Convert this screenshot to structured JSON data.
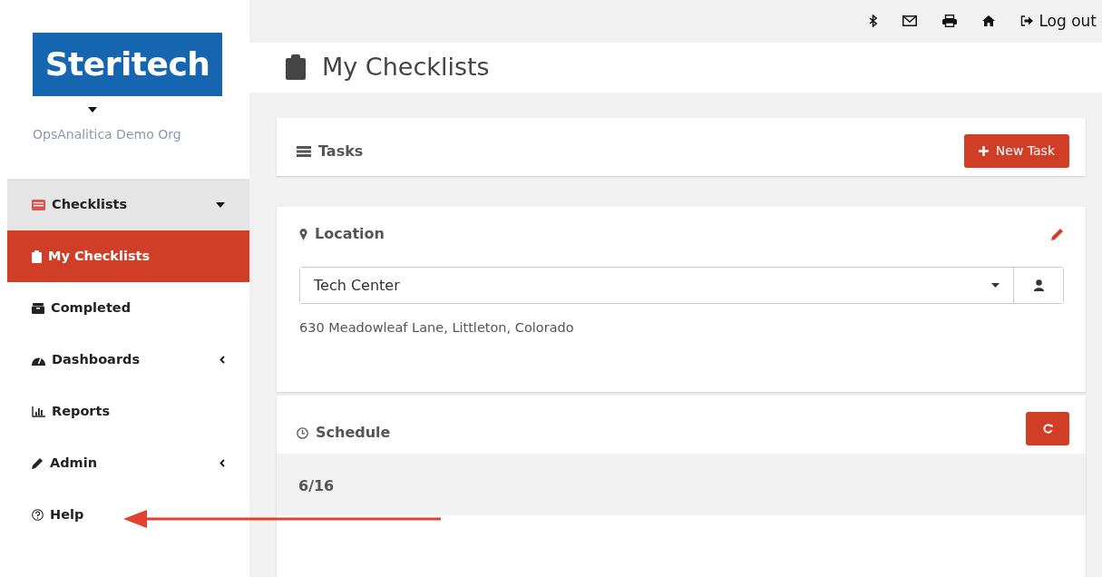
{
  "logo": {
    "text": "Steritech"
  },
  "org": {
    "name": "OpsAnalitica Demo Org"
  },
  "sidebar": {
    "items": [
      {
        "label": "Checklists",
        "selected": false,
        "expanded": true
      },
      {
        "label": "My Checklists",
        "selected": true
      },
      {
        "label": "Completed",
        "selected": false
      },
      {
        "label": "Dashboards",
        "selected": false,
        "expanded": false
      },
      {
        "label": "Reports",
        "selected": false
      },
      {
        "label": "Admin",
        "selected": false,
        "expanded": false
      },
      {
        "label": "Help",
        "selected": false
      }
    ]
  },
  "topbar": {
    "logout": "Log out"
  },
  "page": {
    "title": "My Checklists"
  },
  "tasks": {
    "title": "Tasks",
    "button": "New Task"
  },
  "location": {
    "title": "Location",
    "value": "Tech Center",
    "address": "630 Meadowleaf Lane, Littleton, Colorado"
  },
  "schedule": {
    "title": "Schedule",
    "date": "6/16"
  }
}
